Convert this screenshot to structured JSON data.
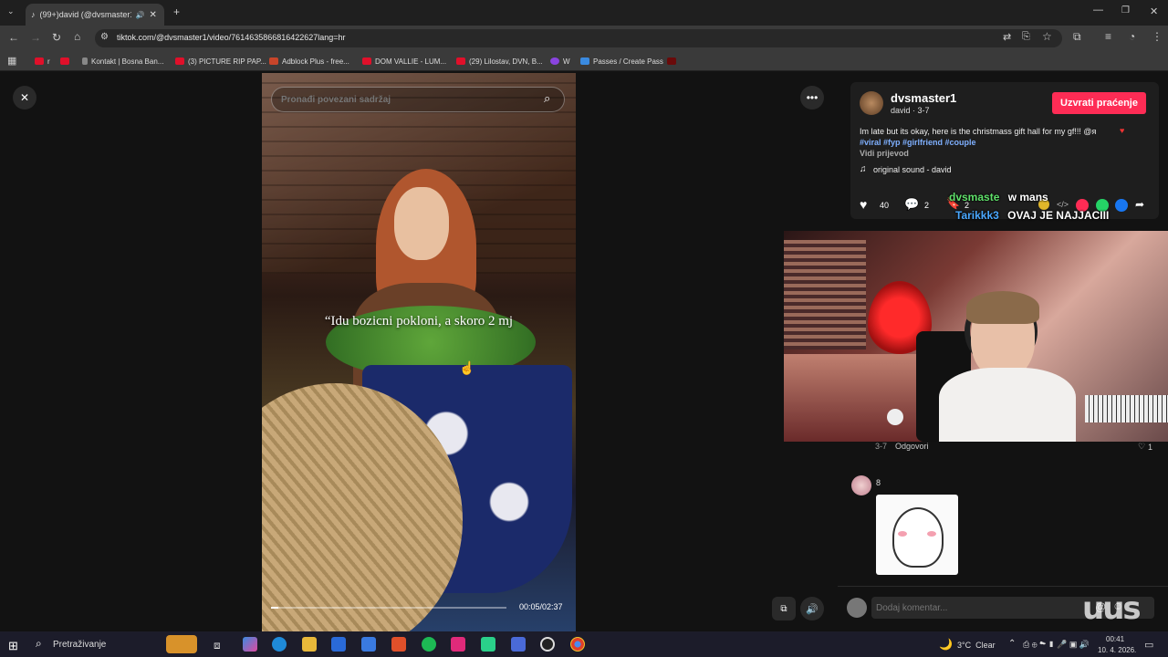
{
  "browser": {
    "tab_title": "(99+)david (@dvsmaster1)",
    "url": "tiktok.com/@dvsmaster1/video/7614635866816422627lang=hr",
    "bookmarks": [
      {
        "label": "r"
      },
      {
        "label": ""
      },
      {
        "label": "Kontakt | Bosna Ban..."
      },
      {
        "label": "(3) PICTURE RIP PAP..."
      },
      {
        "label": "Adblock Plus - free..."
      },
      {
        "label": "DOM VALLIE - LUM..."
      },
      {
        "label": "(29) Lilostav, DVN, B..."
      },
      {
        "label": "W"
      },
      {
        "label": "Passes / Create Pass"
      }
    ]
  },
  "video": {
    "search_placeholder": "Pronađi povezani sadržaj",
    "caption": "“Idu bozicni pokloni, a skoro 2 mj",
    "time": "00:05/02:37",
    "progress": 0.032
  },
  "post": {
    "username": "dvsmaster1",
    "subtitle": "david · 3-7",
    "follow_label": "Uzvrati praćenje",
    "description": "Im late but its okay, here is the christmass gift hall for my gf!!! @я",
    "hashtags": "#viral #fyp #girlfriend #couple",
    "see_translation": "Vidi prijevod",
    "sound": "original sound - david",
    "likes": "40",
    "comments": "2",
    "saves": "2"
  },
  "stream_chat": [
    {
      "user": "dvsmaste",
      "text": "w mans",
      "color": "#5fe06a"
    },
    {
      "user": "Tarikkk3",
      "text": "OVAJ JE NAJJACIII",
      "color": "#4aa8ff"
    }
  ],
  "comments": {
    "reply_meta": "3-7",
    "reply_label": "Odgovori",
    "reply_likes": "1",
    "second_user": "8",
    "input_placeholder": "Dodaj komentar...",
    "watermark": "uus"
  },
  "taskbar": {
    "search_label": "Pretraživanje",
    "weather": "3°C  Clear",
    "time": "00:41",
    "date": "10. 4. 2026."
  }
}
